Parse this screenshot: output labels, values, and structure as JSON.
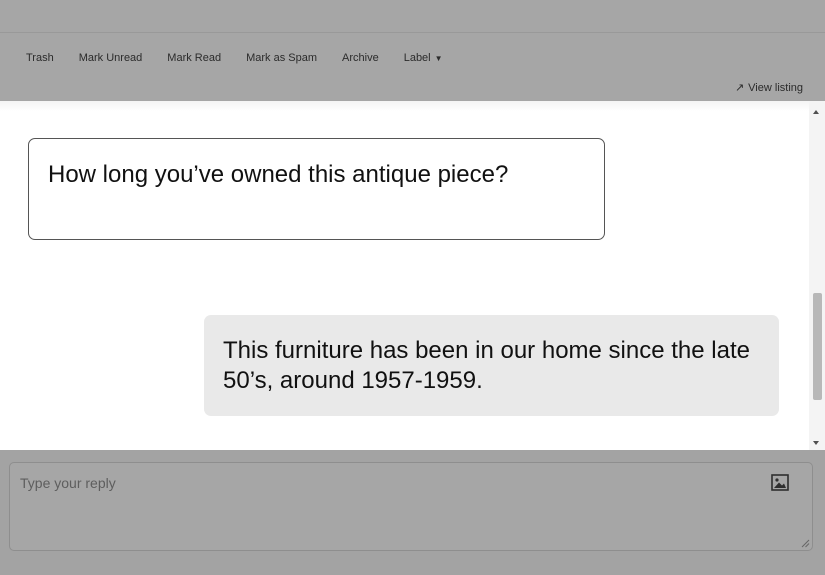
{
  "toolbar": {
    "actions": [
      "Trash",
      "Mark Unread",
      "Mark Read",
      "Mark as Spam",
      "Archive"
    ],
    "label_menu": "Label",
    "view_listing": "View listing"
  },
  "messages": {
    "incoming": "How long you’ve owned this antique piece?",
    "outgoing": "This furniture has been in our home since the late 50’s, around 1957-1959."
  },
  "reply": {
    "placeholder": "Type your reply"
  },
  "icons": {
    "caret": "caret-down-icon",
    "view_listing": "arrow-up-right-icon",
    "attach": "image-icon"
  }
}
